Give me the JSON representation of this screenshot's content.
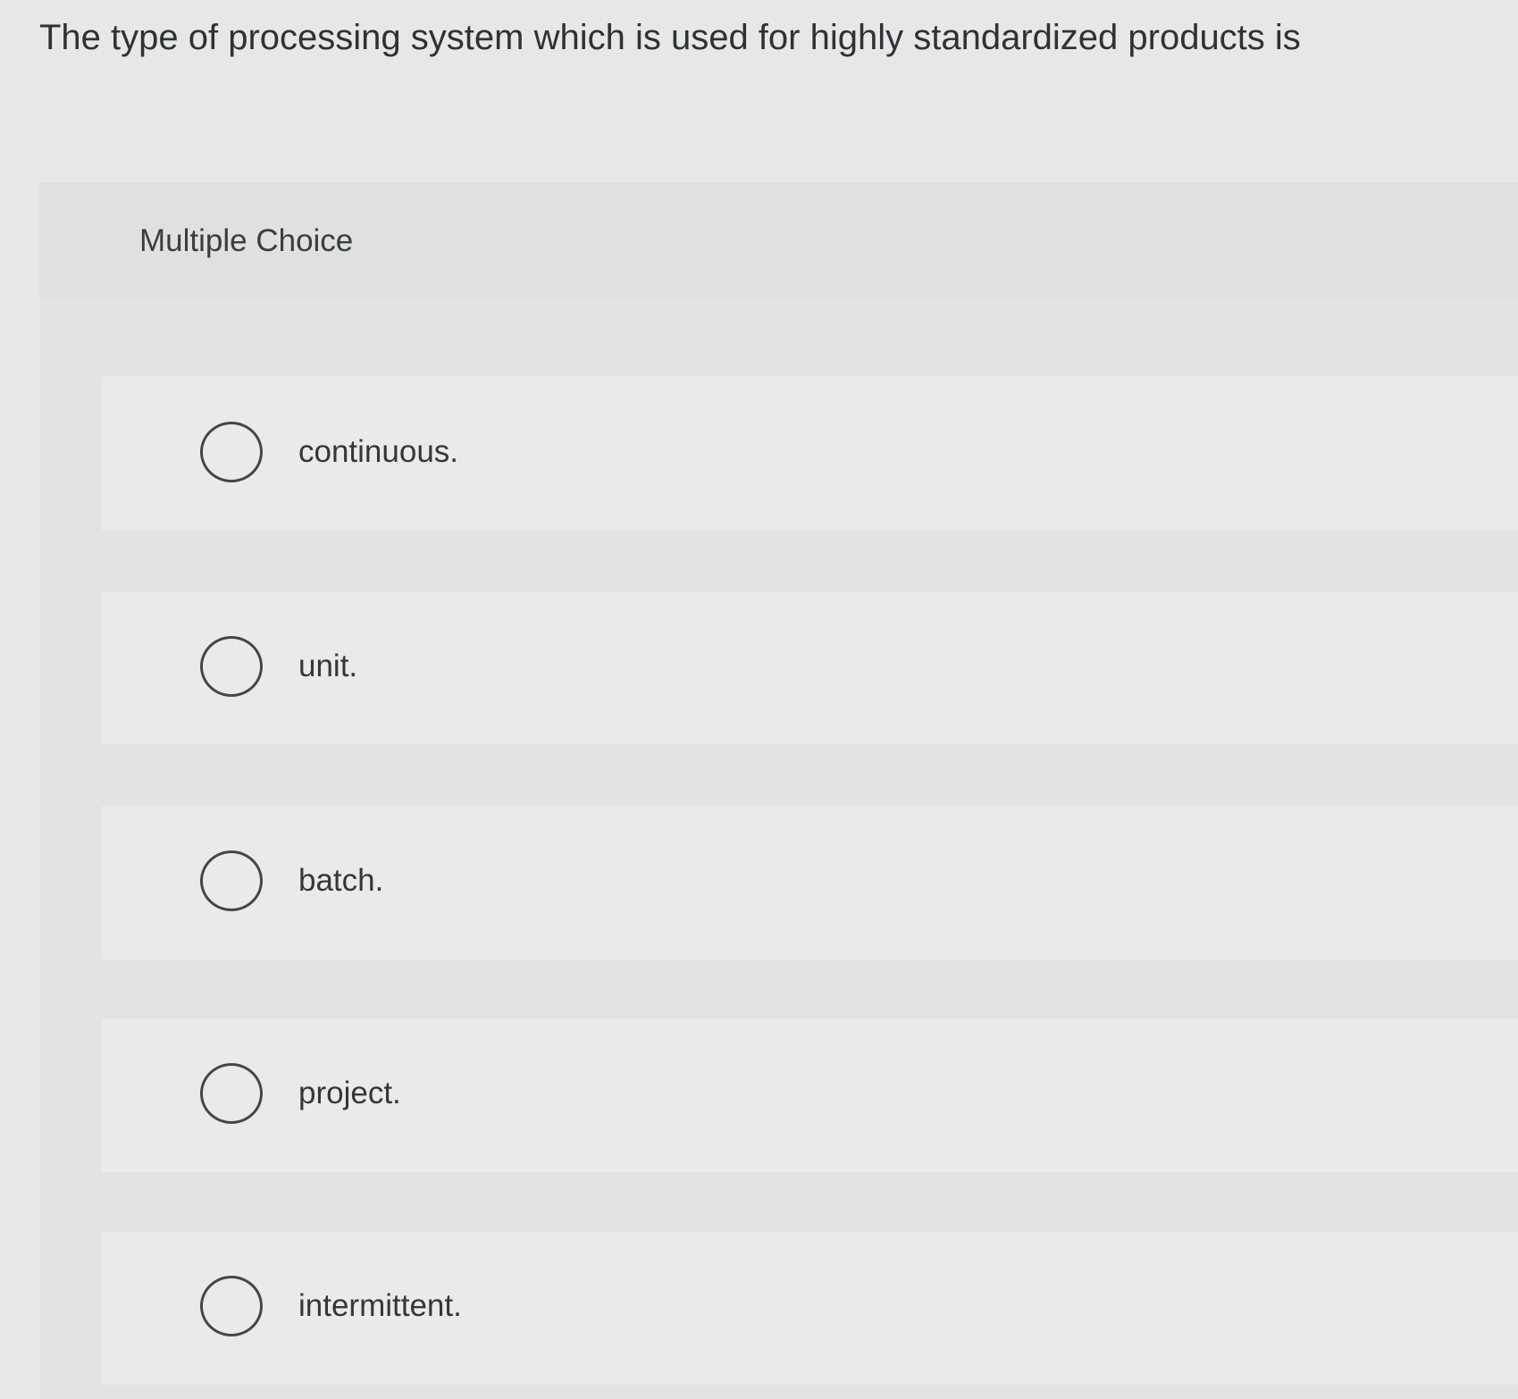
{
  "question": {
    "text": "The type of processing system which is used for highly standardized products is"
  },
  "multiple_choice": {
    "label": "Multiple Choice",
    "options": [
      {
        "text": "continuous.",
        "selected": false
      },
      {
        "text": "unit.",
        "selected": false
      },
      {
        "text": "batch.",
        "selected": false
      },
      {
        "text": "project.",
        "selected": false
      },
      {
        "text": "intermittent.",
        "selected": false
      }
    ]
  },
  "icons": {
    "radio": "radio-button-unselected-icon"
  },
  "colors": {
    "background": "#e6e8e8",
    "text": "#2f3234",
    "radio_border": "#43474a"
  }
}
